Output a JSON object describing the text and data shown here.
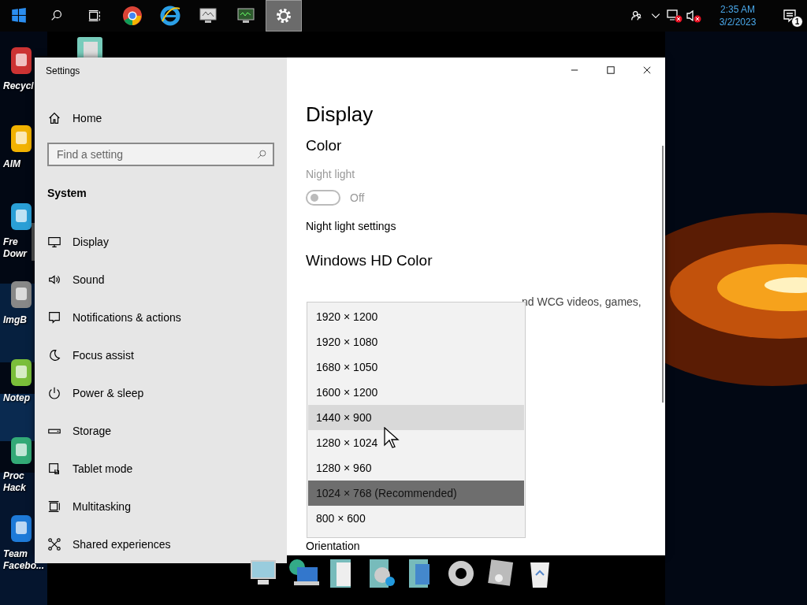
{
  "taskbar": {
    "time": "2:35 AM",
    "date": "3/2/2023",
    "notification_count": "1"
  },
  "desktop_icons": [
    {
      "lines": [
        "Recycl"
      ]
    },
    {
      "lines": [
        "AIM"
      ]
    },
    {
      "lines": [
        "Fre",
        "Dowr"
      ]
    },
    {
      "lines": [
        "ImgB"
      ]
    },
    {
      "lines": [
        "Notep"
      ]
    },
    {
      "lines": [
        "Proc",
        "Hack"
      ]
    },
    {
      "lines": [
        "Team",
        "Facebo..."
      ]
    }
  ],
  "window": {
    "title": "Settings"
  },
  "sidebar": {
    "home": "Home",
    "search": {
      "placeholder": "Find a setting"
    },
    "section": "System",
    "items": [
      {
        "label": "Display",
        "selected": true
      },
      {
        "label": "Sound",
        "selected": false
      },
      {
        "label": "Notifications & actions",
        "selected": false
      },
      {
        "label": "Focus assist",
        "selected": false
      },
      {
        "label": "Power & sleep",
        "selected": false
      },
      {
        "label": "Storage",
        "selected": false
      },
      {
        "label": "Tablet mode",
        "selected": false
      },
      {
        "label": "Multitasking",
        "selected": false
      },
      {
        "label": "Shared experiences",
        "selected": false
      }
    ]
  },
  "content": {
    "title": "Display",
    "color_heading": "Color",
    "night_light": {
      "label": "Night light",
      "disabled": true,
      "on": false,
      "state": "Off"
    },
    "night_light_link": "Night light settings",
    "hd_heading": "Windows HD Color",
    "hd_text": "nd WCG videos, games,",
    "orientation": "Orientation"
  },
  "resolution_dropdown": [
    {
      "label": "1920 × 1200",
      "selected": false,
      "hovered": false
    },
    {
      "label": "1920 × 1080",
      "selected": false,
      "hovered": false
    },
    {
      "label": "1680 × 1050",
      "selected": false,
      "hovered": false
    },
    {
      "label": "1600 × 1200",
      "selected": false,
      "hovered": false
    },
    {
      "label": "1440 × 900",
      "selected": false,
      "hovered": true
    },
    {
      "label": "1280 × 1024",
      "selected": false,
      "hovered": false
    },
    {
      "label": "1280 × 960",
      "selected": false,
      "hovered": false
    },
    {
      "label": "1024 × 768 (Recommended)",
      "selected": true,
      "hovered": false
    },
    {
      "label": "800 × 600",
      "selected": false,
      "hovered": false
    }
  ]
}
